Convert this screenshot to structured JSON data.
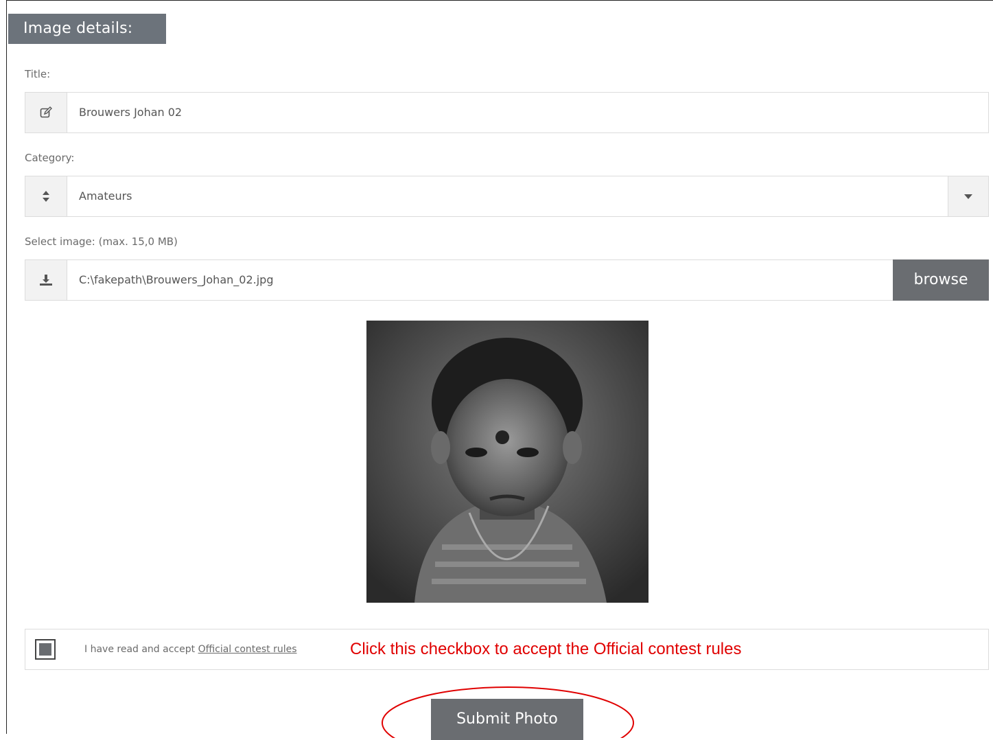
{
  "section": {
    "title": "Image details:"
  },
  "title_field": {
    "label": "Title:",
    "value": "Brouwers Johan 02",
    "icon": "edit-icon"
  },
  "category_field": {
    "label": "Category:",
    "value": "Amateurs",
    "icon": "sort-icon"
  },
  "image_field": {
    "label": "Select image: (max. 15,0 MB)",
    "value": "C:\\fakepath\\Brouwers_Johan_02.jpg",
    "icon": "download-icon",
    "browse_label": "browse"
  },
  "accept": {
    "text": "I have read and accept",
    "link_text": "Official contest rules",
    "checked": true
  },
  "annotation": {
    "text": "Click this checkbox to accept the Official contest rules",
    "color": "#e00000"
  },
  "submit": {
    "label": "Submit Photo"
  },
  "colors": {
    "accent_gray": "#6a6d71",
    "header_gray": "#6c737b",
    "annotation_red": "#e00000"
  }
}
